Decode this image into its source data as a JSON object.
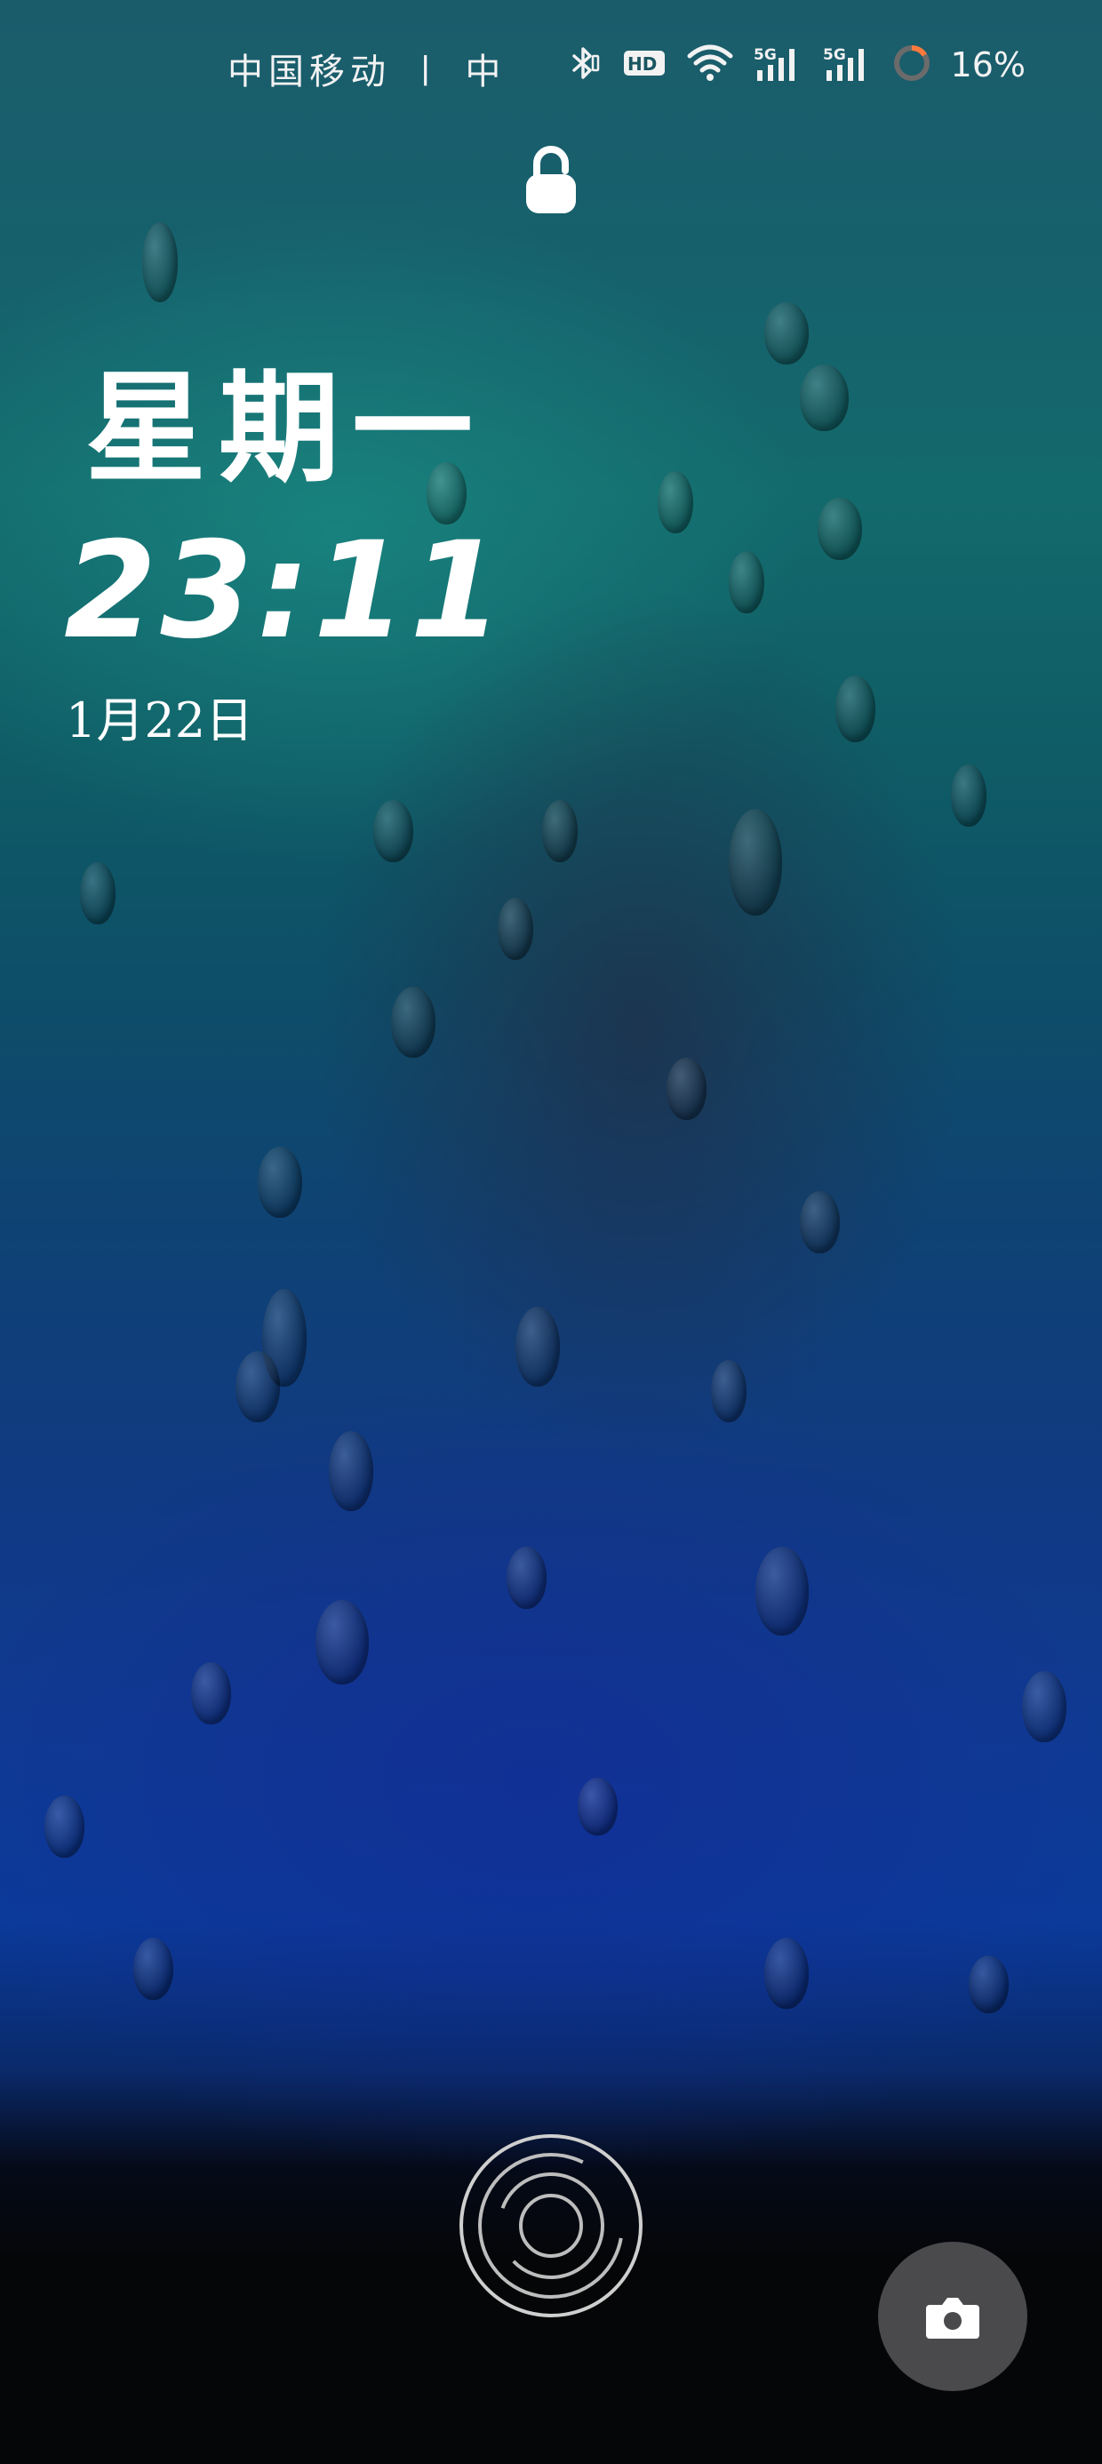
{
  "status_bar": {
    "carrier": "中国移动 〡 中",
    "battery_percent_text": "16%",
    "battery_level": 0.16,
    "icons": [
      "bluetooth-icon",
      "hd-icon",
      "wifi-icon",
      "5g-signal-icon",
      "5g-signal-icon",
      "battery-ring-icon"
    ],
    "hd_label": "HD",
    "network_label_1": "5G",
    "network_label_2": "5G"
  },
  "lock_screen": {
    "weekday": "星期一",
    "time": "23:11",
    "date": "1月22日"
  },
  "colors": {
    "text": "#ffffff",
    "battery_ring_track": "#6b6b6b",
    "battery_ring_fill": "#ff7a3c",
    "camera_button_bg": "#4a4a4c"
  },
  "bottom": {
    "fingerprint_icon": "fingerprint-icon",
    "camera_icon": "camera-icon"
  }
}
